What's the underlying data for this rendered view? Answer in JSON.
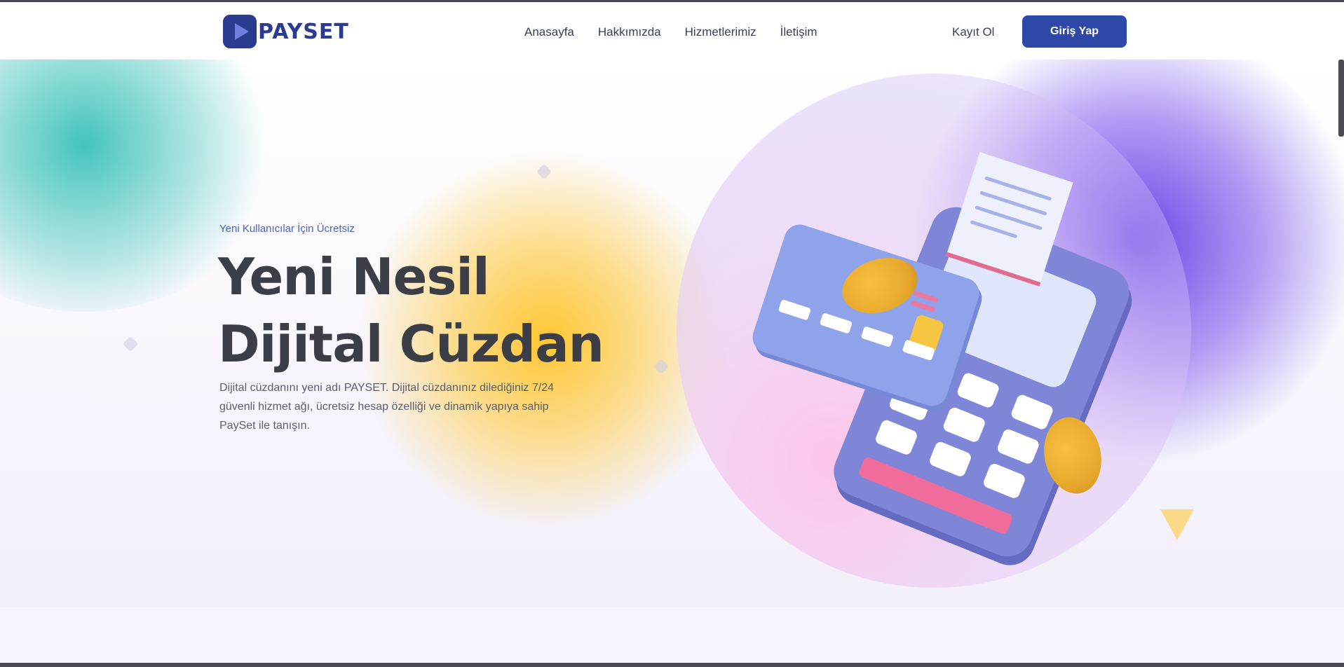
{
  "brand": {
    "logo_text": "PAYSET"
  },
  "nav": {
    "items": [
      {
        "label": "Anasayfa"
      },
      {
        "label": "Hakkımızda"
      },
      {
        "label": "Hizmetlerimiz"
      },
      {
        "label": "İletişim"
      }
    ],
    "login_label": "Kayıt Ol",
    "signin_label": "Giriş Yap"
  },
  "hero": {
    "eyebrow": "Yeni Kullanıcılar İçin Ücretsiz",
    "headline_line1": "Yeni Nesil",
    "headline_line2": "Dijital Cüzdan",
    "description": "Dijital cüzdanını yeni adı PAYSET. Dijital cüzdanınız dilediğiniz 7/24 güvenli hizmet ağı, ücretsiz hesap özelliği ve dinamik yapıya sahip PaySet ile tanışın."
  },
  "colors": {
    "primary": "#2d48a6",
    "accent_yellow": "#ffc428",
    "accent_purple": "#6a40e6",
    "accent_teal": "#30beb4"
  },
  "icons": {
    "illustration": "pos-terminal-card-coins-illustration"
  }
}
